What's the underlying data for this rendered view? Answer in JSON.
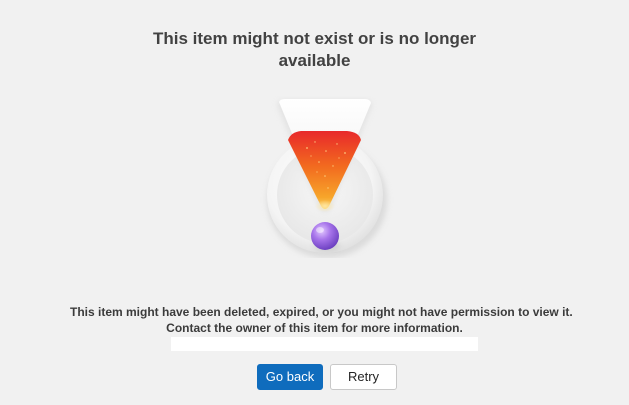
{
  "error": {
    "title": "This item might not exist or is no longer available",
    "message_line1": "This item might have been deleted, expired, or you might not have permission to view it.",
    "message_line2": "Contact the owner of this item for more information."
  },
  "illustration": {
    "icon": "warning-exclamation-icon"
  },
  "actions": {
    "go_back_label": "Go back",
    "retry_label": "Retry"
  },
  "colors": {
    "background": "#f1f1f1",
    "primary_button": "#0f6cbd",
    "text": "#424242"
  }
}
